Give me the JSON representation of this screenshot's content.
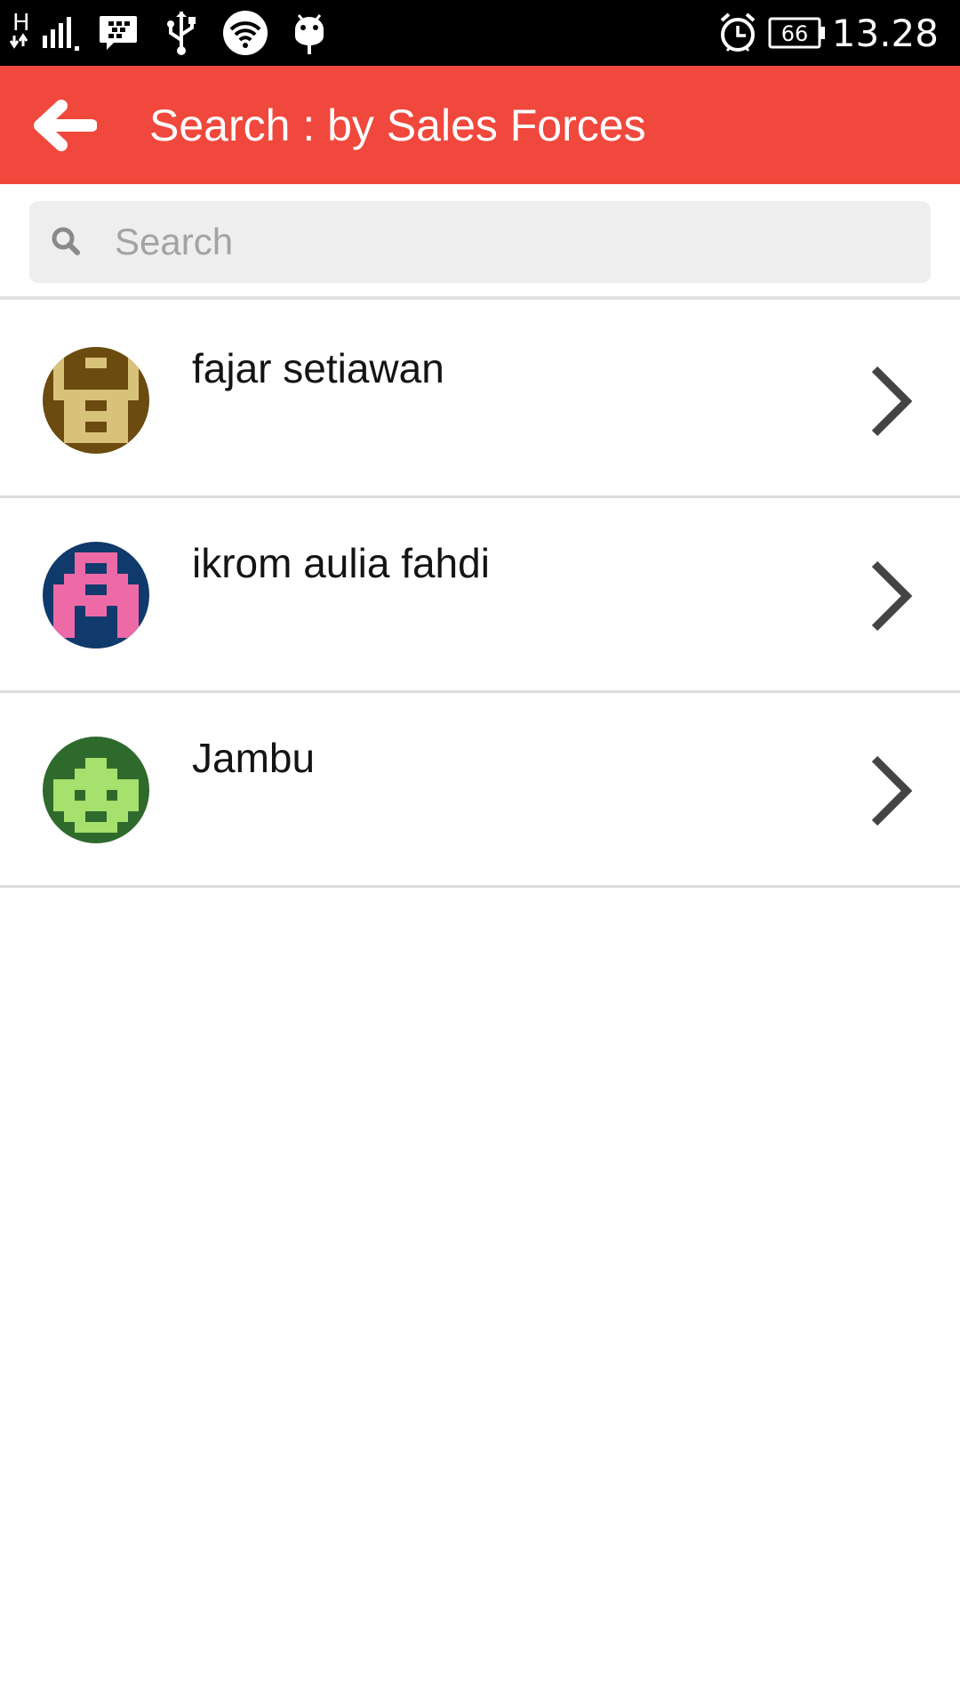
{
  "status_bar": {
    "network_label": "H",
    "battery_level": "66",
    "time": "13.28",
    "icons": [
      "signal-icon",
      "bbm-icon",
      "usb-icon",
      "wifi-icon",
      "android-debug-icon",
      "alarm-icon",
      "battery-icon"
    ]
  },
  "app_bar": {
    "title": "Search : by Sales Forces",
    "back_icon": "back-arrow-icon",
    "color": "#f0483d"
  },
  "search": {
    "placeholder": "Search",
    "value": "",
    "icon": "search-icon"
  },
  "sales_forces": [
    {
      "name": "fajar setiawan",
      "avatar_bg": "#6b4b0f",
      "avatar_fg": "#d8c179"
    },
    {
      "name": "ikrom aulia fahdi",
      "avatar_bg": "#0f3a6b",
      "avatar_fg": "#ee6aa7"
    },
    {
      "name": "Jambu",
      "avatar_bg": "#2f6a2d",
      "avatar_fg": "#a6e06d"
    }
  ]
}
